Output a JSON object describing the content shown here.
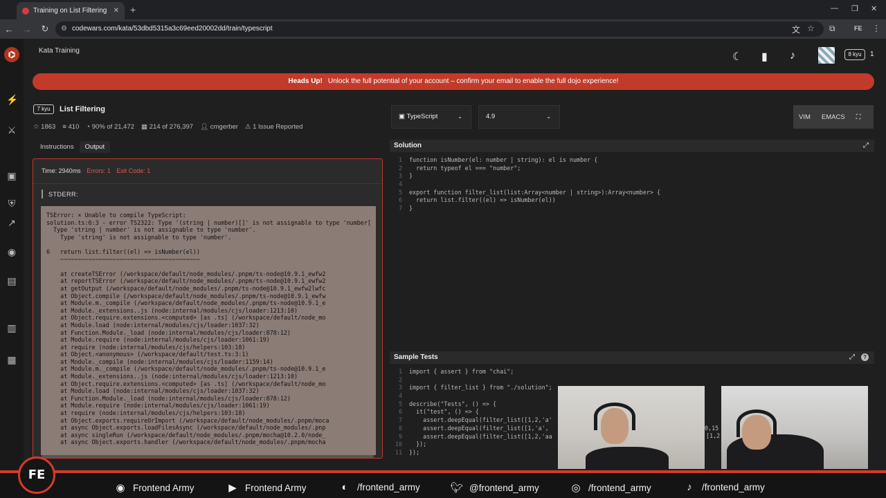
{
  "browser": {
    "tab_title": "Training on List Filtering | Codewars",
    "url": "codewars.com/kata/53dbd5315a3c69eed20002dd/train/typescript"
  },
  "header": {
    "section_title": "Kata Training",
    "rank_badge": "8 kyu",
    "honor": "1"
  },
  "banner": {
    "strong": "Heads Up!",
    "text": "Unlock the full potential of your account – confirm your email to enable the full dojo experience!"
  },
  "kata": {
    "kyu": "7 kyu",
    "name": "List Filtering",
    "stars": "1863",
    "collections": "410",
    "satisfaction": "90% of 21,472",
    "completions": "214 of 276,397",
    "author": "cmgerber",
    "issues": "1 Issue Reported"
  },
  "left_tabs": {
    "instructions": "Instructions",
    "output": "Output"
  },
  "output": {
    "time": "Time: 2940ms",
    "errors": "Errors: 1",
    "exit": "Exit Code: 1",
    "stderr_label": "STDERR:",
    "lines": [
      "TSError: × Unable to compile TypeScript:",
      "solution.ts:6:3 - error TS2322: Type '(string | number)[]' is not assignable to type 'number[]'.",
      "  Type 'string | number' is not assignable to type 'number'.",
      "    Type 'string' is not assignable to type 'number'.",
      "",
      "6   return list.filter((el) => isNumber(el))",
      "    ~~~~~~~~~~~~~~~~~~~~~~~~~~~~~~~~~~~~~~~~",
      "",
      "    at createTSError (/workspace/default/node_modules/.pnpm/ts-node@10.9.1_ewfw2",
      "    at reportTSError (/workspace/default/node_modules/.pnpm/ts-node@10.9.1_ewfw2",
      "    at getOutput (/workspace/default/node_modules/.pnpm/ts-node@10.9.1_ewfw2lwfc",
      "    at Object.compile (/workspace/default/node_modules/.pnpm/ts-node@10.9.1_ewfw",
      "    at Module.m._compile (/workspace/default/node_modules/.pnpm/ts-node@10.9.1_e",
      "    at Module._extensions..js (node:internal/modules/cjs/loader:1213:10)",
      "    at Object.require.extensions.<computed> [as .ts] (/workspace/default/node_mo",
      "    at Module.load (node:internal/modules/cjs/loader:1037:32)",
      "    at Function.Module._load (node:internal/modules/cjs/loader:878:12)",
      "    at Module.require (node:internal/modules/cjs/loader:1061:19)",
      "    at require (node:internal/modules/cjs/helpers:103:18)",
      "    at Object.<anonymous> (/workspace/default/test.ts:3:1)",
      "    at Module._compile (node:internal/modules/cjs/loader:1159:14)",
      "    at Module.m._compile (/workspace/default/node_modules/.pnpm/ts-node@10.9.1_e",
      "    at Module._extensions..js (node:internal/modules/cjs/loader:1213:10)",
      "    at Object.require.extensions.<computed> [as .ts] (/workspace/default/node_mo",
      "    at Module.load (node:internal/modules/cjs/loader:1037:32)",
      "    at Function.Module._load (node:internal/modules/cjs/loader:878:12)",
      "    at Module.require (node:internal/modules/cjs/loader:1061:19)",
      "    at require (node:internal/modules/cjs/helpers:103:18)",
      "    at Object.exports.requireOrImport (/workspace/default/node_modules/.pnpm/moca",
      "    at async Object.exports.loadFilesAsync (/workspace/default/node_modules/.pnp",
      "    at async singleRun (/workspace/default/node_modules/.pnpm/mocha@10.2.0/node_",
      "    at async Object.exports.handler (/workspace/default/node_modules/.pnpm/mocha"
    ]
  },
  "editor_toolbar": {
    "language": "TypeScript",
    "version": "4.9",
    "vim": "VIM",
    "emacs": "EMACS"
  },
  "solution": {
    "title": "Solution",
    "lines": [
      {
        "n": "1",
        "code": "function isNumber(el: number | string): el is number {"
      },
      {
        "n": "2",
        "code": "  return typeof el === \"number\";"
      },
      {
        "n": "3",
        "code": "}"
      },
      {
        "n": "4",
        "code": ""
      },
      {
        "n": "5",
        "code": "export function filter_list(list:Array<number | string>):Array<number> {"
      },
      {
        "n": "6",
        "code": "  return list.filter((el) => isNumber(el))"
      },
      {
        "n": "7",
        "code": "}"
      }
    ]
  },
  "sample_tests": {
    "title": "Sample Tests",
    "lines": [
      {
        "n": "1",
        "code": "import { assert } from \"chai\";"
      },
      {
        "n": "2",
        "code": ""
      },
      {
        "n": "3",
        "code": "import { filter_list } from \"./solution\";"
      },
      {
        "n": "4",
        "code": ""
      },
      {
        "n": "5",
        "code": "describe(\"Tests\", () => {"
      },
      {
        "n": "6",
        "code": "  it(\"test\", () => {"
      },
      {
        "n": "7",
        "code": "    assert.deepEqual(filter_list([1,2,'a'"
      },
      {
        "n": "8",
        "code": "    assert.deepEqual(filter_list([1,'a',"
      },
      {
        "n": "9",
        "code": "    assert.deepEqual(filter_list([1,2,'aa"
      },
      {
        "n": "10",
        "code": "  });"
      },
      {
        "n": "11",
        "code": "});"
      }
    ],
    "overflow_right_1": "0,15",
    "overflow_right_2": "[1,2"
  },
  "footer": {
    "logo": "FE",
    "items": [
      {
        "icon": "spotify-icon",
        "label": "Frontend Army"
      },
      {
        "icon": "youtube-icon",
        "label": "Frontend Army"
      },
      {
        "icon": "github-icon",
        "label": "/frontend_army"
      },
      {
        "icon": "twitter-icon",
        "label": "@frontend_army"
      },
      {
        "icon": "instagram-icon",
        "label": "/frontend_army"
      },
      {
        "icon": "tiktok-icon",
        "label": "/frontend_army"
      }
    ]
  },
  "colors": {
    "accent": "#d63b2b",
    "error_border": "#c0392b",
    "banner": "#c23b2a"
  }
}
